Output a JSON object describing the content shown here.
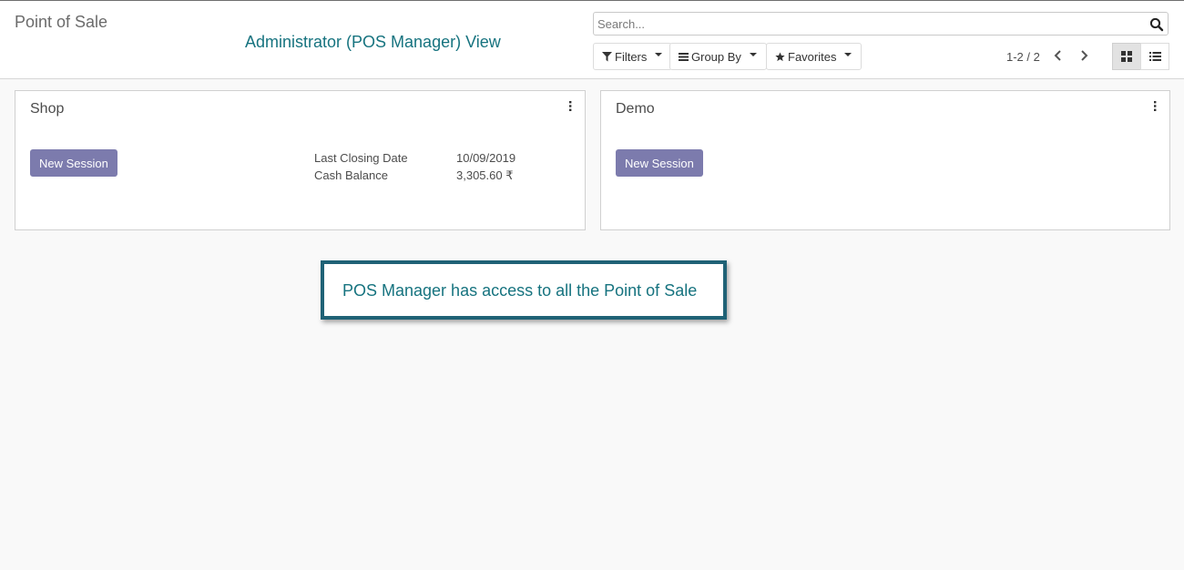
{
  "header": {
    "title": "Point of Sale",
    "view_caption": "Administrator (POS Manager) View"
  },
  "search": {
    "placeholder": "Search...",
    "value": ""
  },
  "toolbar": {
    "filters_label": "Filters",
    "group_by_label": "Group By",
    "favorites_label": "Favorites",
    "pager": "1-2 / 2"
  },
  "cards": [
    {
      "name": "Shop",
      "button_label": "New Session",
      "stats": [
        {
          "label": "Last Closing Date",
          "value": "10/09/2019"
        },
        {
          "label": "Cash Balance",
          "value": "3,305.60 ₹"
        }
      ]
    },
    {
      "name": "Demo",
      "button_label": "New Session"
    }
  ],
  "annotation": {
    "text": "POS Manager has access to all the Point of Sale"
  },
  "colors": {
    "accent": "#7c7bad",
    "caption": "#16737f",
    "annotation_border": "#1f6276"
  },
  "icons": [
    "search-icon",
    "filter-icon",
    "group-by-icon",
    "star-icon",
    "chevron-left-icon",
    "chevron-right-icon",
    "kanban-view-icon",
    "list-view-icon",
    "kebab-menu-icon"
  ]
}
